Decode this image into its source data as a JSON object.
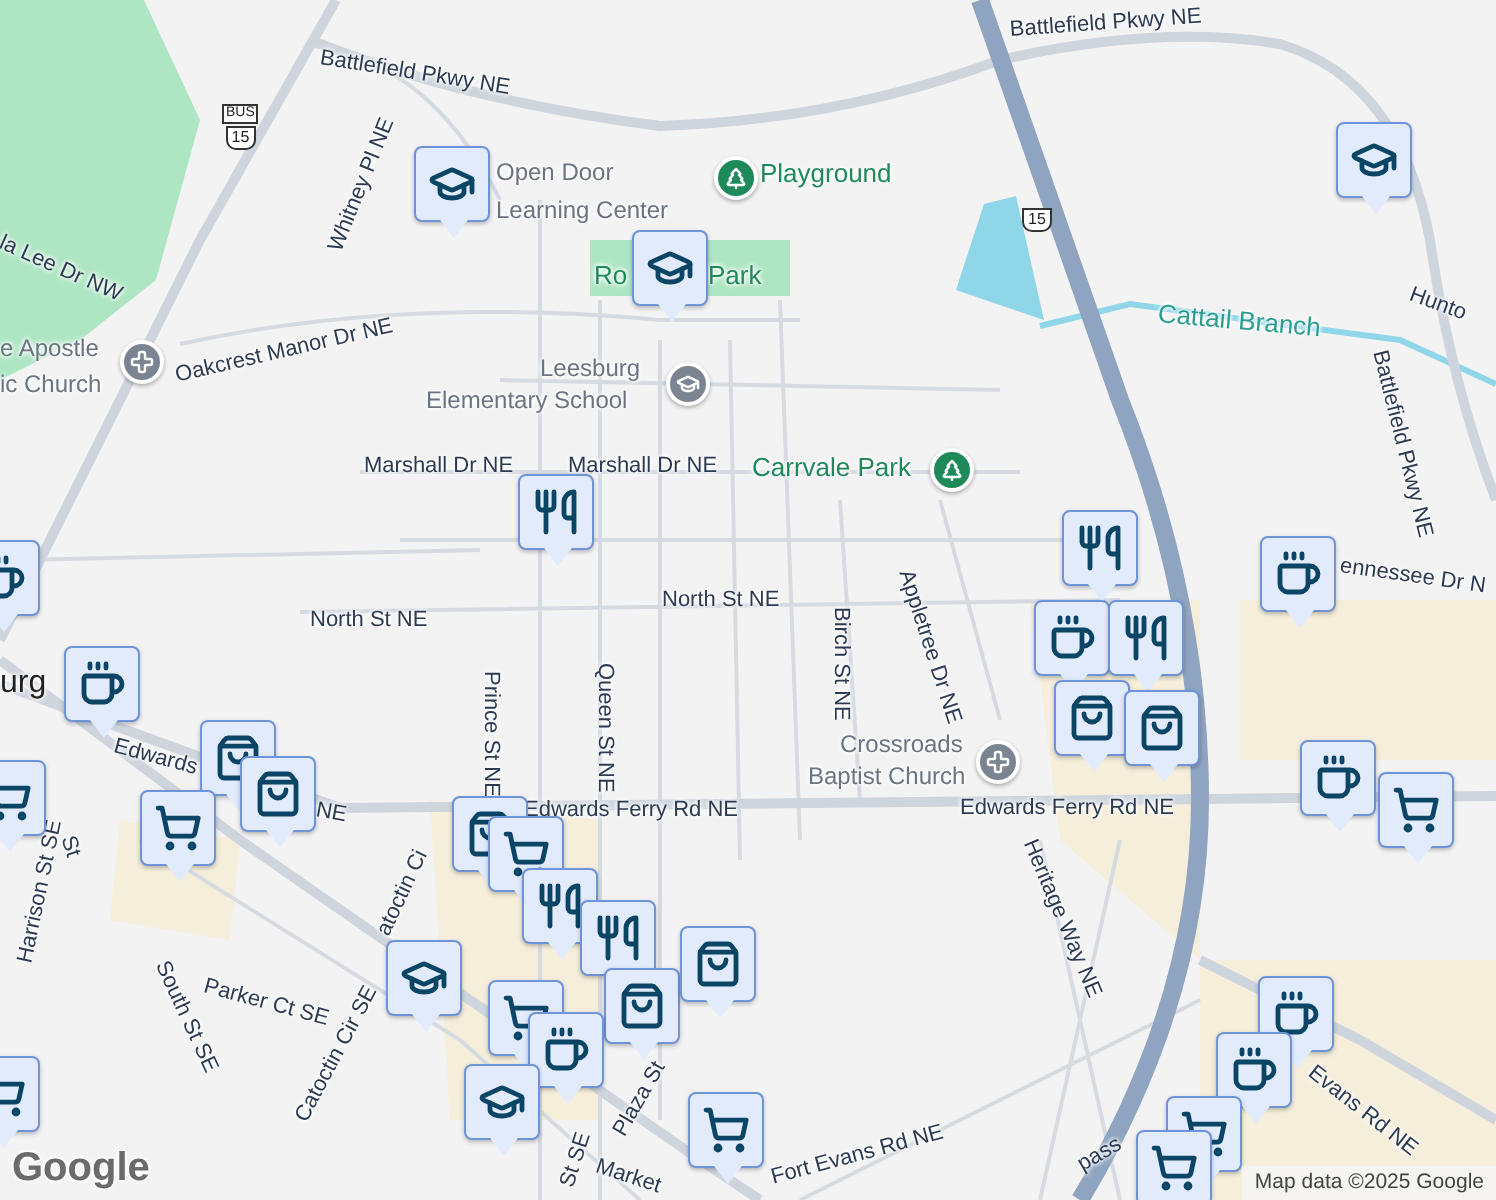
{
  "map": {
    "labels": [
      {
        "text": "Battlefield Pkwy NE",
        "kind": "road"
      },
      {
        "text": "Battlefield Pkwy NE",
        "kind": "road"
      },
      {
        "text": "Playground",
        "kind": "park"
      },
      {
        "text": "Open Door",
        "kind": "poi"
      },
      {
        "text": "Learning Center",
        "kind": "poi"
      },
      {
        "text": "Whitney Pl NE",
        "kind": "road"
      },
      {
        "text": "la Lee Dr NW",
        "kind": "road"
      },
      {
        "text": "Ro",
        "kind": "park"
      },
      {
        "text": "Park",
        "kind": "park"
      },
      {
        "text": "Cattail Branch",
        "kind": "water"
      },
      {
        "text": "Hunto",
        "kind": "road"
      },
      {
        "text": "Battlefield Pkwy NE",
        "kind": "road"
      },
      {
        "text": "e Apostle",
        "kind": "poi"
      },
      {
        "text": "ic Church",
        "kind": "poi"
      },
      {
        "text": "Oakcrest Manor Dr NE",
        "kind": "road"
      },
      {
        "text": "Leesburg",
        "kind": "poi"
      },
      {
        "text": "Elementary School",
        "kind": "poi"
      },
      {
        "text": "Marshall Dr NE",
        "kind": "road"
      },
      {
        "text": "Marshall Dr NE",
        "kind": "road"
      },
      {
        "text": "Carrvale Park",
        "kind": "park"
      },
      {
        "text": "ennessee Dr N",
        "kind": "road"
      },
      {
        "text": "North St NE",
        "kind": "road"
      },
      {
        "text": "North St NE",
        "kind": "road"
      },
      {
        "text": "Appletree Dr NE",
        "kind": "road"
      },
      {
        "text": "Birch St NE",
        "kind": "road"
      },
      {
        "text": "Prince St NE",
        "kind": "road"
      },
      {
        "text": "Queen St NE",
        "kind": "road"
      },
      {
        "text": "urg",
        "kind": "place"
      },
      {
        "text": "Edwards",
        "kind": "road"
      },
      {
        "text": "NE",
        "kind": "road"
      },
      {
        "text": "Crossroads",
        "kind": "poi"
      },
      {
        "text": "Baptist Church",
        "kind": "poi"
      },
      {
        "text": "Edwards Ferry Rd NE",
        "kind": "road"
      },
      {
        "text": "Edwards Ferry Rd NE",
        "kind": "road"
      },
      {
        "text": "St",
        "kind": "road"
      },
      {
        "text": "Harrison St SE",
        "kind": "road"
      },
      {
        "text": "atoctin Ci",
        "kind": "road"
      },
      {
        "text": "Heritage Way NE",
        "kind": "road"
      },
      {
        "text": "South St SE",
        "kind": "road"
      },
      {
        "text": "Parker Ct SE",
        "kind": "road"
      },
      {
        "text": "Catoctin Cir SE",
        "kind": "road"
      },
      {
        "text": "Evans Rd NE",
        "kind": "road"
      },
      {
        "text": "Plaza St",
        "kind": "road"
      },
      {
        "text": "St SE",
        "kind": "road"
      },
      {
        "text": "Market",
        "kind": "road"
      },
      {
        "text": "Fort Evans Rd NE",
        "kind": "road"
      },
      {
        "text": "pass",
        "kind": "road"
      }
    ],
    "places": [
      {
        "kind": "park"
      },
      {
        "kind": "church"
      },
      {
        "kind": "school"
      },
      {
        "kind": "park"
      },
      {
        "kind": "church"
      }
    ],
    "shields": [
      {
        "kind": "bus",
        "label": "BUS",
        "number": "15"
      },
      {
        "kind": "us",
        "number": "15"
      }
    ],
    "pins": [
      {
        "kind": "school"
      },
      {
        "kind": "school"
      },
      {
        "kind": "restaurant"
      },
      {
        "kind": "school"
      },
      {
        "kind": "cafe"
      },
      {
        "kind": "restaurant"
      },
      {
        "kind": "cafe"
      },
      {
        "kind": "cafe"
      },
      {
        "kind": "restaurant"
      },
      {
        "kind": "cafe"
      },
      {
        "kind": "shopping"
      },
      {
        "kind": "shopping"
      },
      {
        "kind": "shopping"
      },
      {
        "kind": "shopping"
      },
      {
        "kind": "grocery"
      },
      {
        "kind": "grocery"
      },
      {
        "kind": "shopping"
      },
      {
        "kind": "grocery"
      },
      {
        "kind": "restaurant"
      },
      {
        "kind": "restaurant"
      },
      {
        "kind": "school"
      },
      {
        "kind": "shopping"
      },
      {
        "kind": "shopping"
      },
      {
        "kind": "grocery"
      },
      {
        "kind": "cafe"
      },
      {
        "kind": "school"
      },
      {
        "kind": "grocery"
      },
      {
        "kind": "cafe"
      },
      {
        "kind": "grocery"
      },
      {
        "kind": "cafe"
      },
      {
        "kind": "cafe"
      },
      {
        "kind": "grocery"
      },
      {
        "kind": "grocery"
      },
      {
        "kind": "grocery"
      }
    ]
  },
  "logo": "Google",
  "attribution": "Map data ©2025 Google"
}
